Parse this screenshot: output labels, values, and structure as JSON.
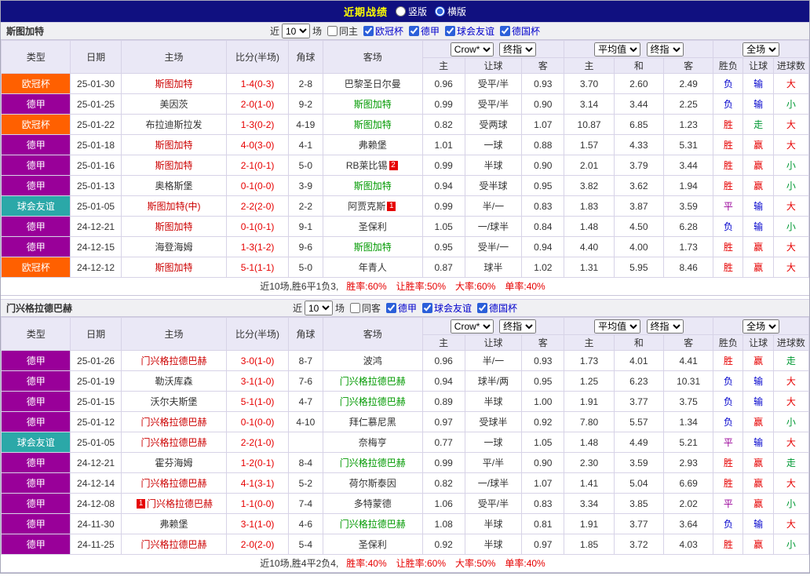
{
  "titlebar": {
    "title": "近期战绩",
    "vertical": "竖版",
    "horizontal": "横版"
  },
  "filter_labels": {
    "near": "近",
    "count": "10",
    "games": "场"
  },
  "table_header": {
    "type": "类型",
    "date": "日期",
    "home": "主场",
    "score": "比分(半场)",
    "corner": "角球",
    "away": "客场",
    "odds_company": "Crow*",
    "odds_kind": "终指",
    "avg_company": "平均值",
    "avg_kind": "终指",
    "full": "全场",
    "sub": [
      "主",
      "让球",
      "客",
      "主",
      "和",
      "客",
      "胜负",
      "让球",
      "进球数"
    ]
  },
  "league_colors": {
    "欧冠杯": "#ff6000",
    "德甲": "#990099",
    "球会友谊": "#2ba8a8"
  },
  "result_colors": {
    "胜": "#e60000",
    "平": "#990099",
    "负": "#0000cc",
    "赢": "#e60000",
    "输": "#0000cc",
    "走": "#009933",
    "大": "#e60000",
    "小": "#009933"
  },
  "team_colors": {
    "focal_home": "#cc0000",
    "focal_away": "#009900",
    "other": "#333333"
  },
  "sections": [
    {
      "team": "斯图加特",
      "filter_checkboxes": [
        {
          "label": "同主",
          "checked": false
        },
        {
          "label": "欧冠杯",
          "checked": true
        },
        {
          "label": "德甲",
          "checked": true
        },
        {
          "label": "球会友谊",
          "checked": true
        },
        {
          "label": "德国杯",
          "checked": true
        }
      ],
      "rows": [
        {
          "league": "欧冠杯",
          "date": "25-01-30",
          "home": "斯图加特",
          "home_focal": true,
          "home_badge": "",
          "score": "1-4(0-3)",
          "corner": "2-8",
          "away": "巴黎圣日尔曼",
          "away_focal": false,
          "away_badge": "",
          "odds_home": "0.96",
          "handicap": "受平/半",
          "odds_away": "0.93",
          "avg_home": "3.70",
          "avg_draw": "2.60",
          "avg_away": "2.49",
          "result": "负",
          "handicap_result": "输",
          "goals_result": "大"
        },
        {
          "league": "德甲",
          "date": "25-01-25",
          "home": "美因茨",
          "home_focal": false,
          "home_badge": "",
          "score": "2-0(1-0)",
          "corner": "9-2",
          "away": "斯图加特",
          "away_focal": true,
          "away_badge": "",
          "odds_home": "0.99",
          "handicap": "受平/半",
          "odds_away": "0.90",
          "avg_home": "3.14",
          "avg_draw": "3.44",
          "avg_away": "2.25",
          "result": "负",
          "handicap_result": "输",
          "goals_result": "小"
        },
        {
          "league": "欧冠杯",
          "date": "25-01-22",
          "home": "布拉迪斯拉发",
          "home_focal": false,
          "home_badge": "",
          "score": "1-3(0-2)",
          "corner": "4-19",
          "away": "斯图加特",
          "away_focal": true,
          "away_badge": "",
          "odds_home": "0.82",
          "handicap": "受两球",
          "odds_away": "1.07",
          "avg_home": "10.87",
          "avg_draw": "6.85",
          "avg_away": "1.23",
          "result": "胜",
          "handicap_result": "走",
          "goals_result": "大"
        },
        {
          "league": "德甲",
          "date": "25-01-18",
          "home": "斯图加特",
          "home_focal": true,
          "home_badge": "",
          "score": "4-0(3-0)",
          "corner": "4-1",
          "away": "弗赖堡",
          "away_focal": false,
          "away_badge": "",
          "odds_home": "1.01",
          "handicap": "一球",
          "odds_away": "0.88",
          "avg_home": "1.57",
          "avg_draw": "4.33",
          "avg_away": "5.31",
          "result": "胜",
          "handicap_result": "赢",
          "goals_result": "大"
        },
        {
          "league": "德甲",
          "date": "25-01-16",
          "home": "斯图加特",
          "home_focal": true,
          "home_badge": "",
          "score": "2-1(0-1)",
          "corner": "5-0",
          "away": "RB莱比锡",
          "away_focal": false,
          "away_badge": "2",
          "odds_home": "0.99",
          "handicap": "半球",
          "odds_away": "0.90",
          "avg_home": "2.01",
          "avg_draw": "3.79",
          "avg_away": "3.44",
          "result": "胜",
          "handicap_result": "赢",
          "goals_result": "小"
        },
        {
          "league": "德甲",
          "date": "25-01-13",
          "home": "奥格斯堡",
          "home_focal": false,
          "home_badge": "",
          "score": "0-1(0-0)",
          "corner": "3-9",
          "away": "斯图加特",
          "away_focal": true,
          "away_badge": "",
          "odds_home": "0.94",
          "handicap": "受半球",
          "odds_away": "0.95",
          "avg_home": "3.82",
          "avg_draw": "3.62",
          "avg_away": "1.94",
          "result": "胜",
          "handicap_result": "赢",
          "goals_result": "小"
        },
        {
          "league": "球会友谊",
          "date": "25-01-05",
          "home": "斯图加特(中)",
          "home_focal": true,
          "home_badge": "",
          "score": "2-2(2-0)",
          "corner": "2-2",
          "away": "阿贾克斯",
          "away_focal": false,
          "away_badge": "1",
          "odds_home": "0.99",
          "handicap": "半/一",
          "odds_away": "0.83",
          "avg_home": "1.83",
          "avg_draw": "3.87",
          "avg_away": "3.59",
          "result": "平",
          "handicap_result": "输",
          "goals_result": "大"
        },
        {
          "league": "德甲",
          "date": "24-12-21",
          "home": "斯图加特",
          "home_focal": true,
          "home_badge": "",
          "score": "0-1(0-1)",
          "corner": "9-1",
          "away": "圣保利",
          "away_focal": false,
          "away_badge": "",
          "odds_home": "1.05",
          "handicap": "一/球半",
          "odds_away": "0.84",
          "avg_home": "1.48",
          "avg_draw": "4.50",
          "avg_away": "6.28",
          "result": "负",
          "handicap_result": "输",
          "goals_result": "小"
        },
        {
          "league": "德甲",
          "date": "24-12-15",
          "home": "海登海姆",
          "home_focal": false,
          "home_badge": "",
          "score": "1-3(1-2)",
          "corner": "9-6",
          "away": "斯图加特",
          "away_focal": true,
          "away_badge": "",
          "odds_home": "0.95",
          "handicap": "受半/一",
          "odds_away": "0.94",
          "avg_home": "4.40",
          "avg_draw": "4.00",
          "avg_away": "1.73",
          "result": "胜",
          "handicap_result": "赢",
          "goals_result": "大"
        },
        {
          "league": "欧冠杯",
          "date": "24-12-12",
          "home": "斯图加特",
          "home_focal": true,
          "home_badge": "",
          "score": "5-1(1-1)",
          "corner": "5-0",
          "away": "年青人",
          "away_focal": false,
          "away_badge": "",
          "odds_home": "0.87",
          "handicap": "球半",
          "odds_away": "1.02",
          "avg_home": "1.31",
          "avg_draw": "5.95",
          "avg_away": "8.46",
          "result": "胜",
          "handicap_result": "赢",
          "goals_result": "大"
        }
      ],
      "summary_intro": "近10场,胜6平1负3,",
      "summary_stats": [
        "胜率:60%",
        "让胜率:50%",
        "大率:60%",
        "单率:40%"
      ]
    },
    {
      "team": "门兴格拉德巴赫",
      "filter_checkboxes": [
        {
          "label": "同客",
          "checked": false
        },
        {
          "label": "德甲",
          "checked": true
        },
        {
          "label": "球会友谊",
          "checked": true
        },
        {
          "label": "德国杯",
          "checked": true
        }
      ],
      "rows": [
        {
          "league": "德甲",
          "date": "25-01-26",
          "home": "门兴格拉德巴赫",
          "home_focal": true,
          "home_badge": "",
          "score": "3-0(1-0)",
          "corner": "8-7",
          "away": "波鸿",
          "away_focal": false,
          "away_badge": "",
          "odds_home": "0.96",
          "handicap": "半/一",
          "odds_away": "0.93",
          "avg_home": "1.73",
          "avg_draw": "4.01",
          "avg_away": "4.41",
          "result": "胜",
          "handicap_result": "赢",
          "goals_result": "走"
        },
        {
          "league": "德甲",
          "date": "25-01-19",
          "home": "勒沃库森",
          "home_focal": false,
          "home_badge": "",
          "score": "3-1(1-0)",
          "corner": "7-6",
          "away": "门兴格拉德巴赫",
          "away_focal": true,
          "away_badge": "",
          "odds_home": "0.94",
          "handicap": "球半/两",
          "odds_away": "0.95",
          "avg_home": "1.25",
          "avg_draw": "6.23",
          "avg_away": "10.31",
          "result": "负",
          "handicap_result": "输",
          "goals_result": "大"
        },
        {
          "league": "德甲",
          "date": "25-01-15",
          "home": "沃尔夫斯堡",
          "home_focal": false,
          "home_badge": "",
          "score": "5-1(1-0)",
          "corner": "4-7",
          "away": "门兴格拉德巴赫",
          "away_focal": true,
          "away_badge": "",
          "odds_home": "0.89",
          "handicap": "半球",
          "odds_away": "1.00",
          "avg_home": "1.91",
          "avg_draw": "3.77",
          "avg_away": "3.75",
          "result": "负",
          "handicap_result": "输",
          "goals_result": "大"
        },
        {
          "league": "德甲",
          "date": "25-01-12",
          "home": "门兴格拉德巴赫",
          "home_focal": true,
          "home_badge": "",
          "score": "0-1(0-0)",
          "corner": "4-10",
          "away": "拜仁慕尼黑",
          "away_focal": false,
          "away_badge": "",
          "odds_home": "0.97",
          "handicap": "受球半",
          "odds_away": "0.92",
          "avg_home": "7.80",
          "avg_draw": "5.57",
          "avg_away": "1.34",
          "result": "负",
          "handicap_result": "赢",
          "goals_result": "小"
        },
        {
          "league": "球会友谊",
          "date": "25-01-05",
          "home": "门兴格拉德巴赫",
          "home_focal": true,
          "home_badge": "",
          "score": "2-2(1-0)",
          "corner": "",
          "away": "奈梅亨",
          "away_focal": false,
          "away_badge": "",
          "odds_home": "0.77",
          "handicap": "一球",
          "odds_away": "1.05",
          "avg_home": "1.48",
          "avg_draw": "4.49",
          "avg_away": "5.21",
          "result": "平",
          "handicap_result": "输",
          "goals_result": "大"
        },
        {
          "league": "德甲",
          "date": "24-12-21",
          "home": "霍芬海姆",
          "home_focal": false,
          "home_badge": "",
          "score": "1-2(0-1)",
          "corner": "8-4",
          "away": "门兴格拉德巴赫",
          "away_focal": true,
          "away_badge": "",
          "odds_home": "0.99",
          "handicap": "平/半",
          "odds_away": "0.90",
          "avg_home": "2.30",
          "avg_draw": "3.59",
          "avg_away": "2.93",
          "result": "胜",
          "handicap_result": "赢",
          "goals_result": "走"
        },
        {
          "league": "德甲",
          "date": "24-12-14",
          "home": "门兴格拉德巴赫",
          "home_focal": true,
          "home_badge": "",
          "score": "4-1(3-1)",
          "corner": "5-2",
          "away": "荷尔斯泰因",
          "away_focal": false,
          "away_badge": "",
          "odds_home": "0.82",
          "handicap": "一/球半",
          "odds_away": "1.07",
          "avg_home": "1.41",
          "avg_draw": "5.04",
          "avg_away": "6.69",
          "result": "胜",
          "handicap_result": "赢",
          "goals_result": "大"
        },
        {
          "league": "德甲",
          "date": "24-12-08",
          "home": "门兴格拉德巴赫",
          "home_focal": true,
          "home_badge": "1",
          "score": "1-1(0-0)",
          "corner": "7-4",
          "away": "多特蒙德",
          "away_focal": false,
          "away_badge": "",
          "odds_home": "1.06",
          "handicap": "受平/半",
          "odds_away": "0.83",
          "avg_home": "3.34",
          "avg_draw": "3.85",
          "avg_away": "2.02",
          "result": "平",
          "handicap_result": "赢",
          "goals_result": "小"
        },
        {
          "league": "德甲",
          "date": "24-11-30",
          "home": "弗赖堡",
          "home_focal": false,
          "home_badge": "",
          "score": "3-1(1-0)",
          "corner": "4-6",
          "away": "门兴格拉德巴赫",
          "away_focal": true,
          "away_badge": "",
          "odds_home": "1.08",
          "handicap": "半球",
          "odds_away": "0.81",
          "avg_home": "1.91",
          "avg_draw": "3.77",
          "avg_away": "3.64",
          "result": "负",
          "handicap_result": "输",
          "goals_result": "大"
        },
        {
          "league": "德甲",
          "date": "24-11-25",
          "home": "门兴格拉德巴赫",
          "home_focal": true,
          "home_badge": "",
          "score": "2-0(2-0)",
          "corner": "5-4",
          "away": "圣保利",
          "away_focal": false,
          "away_badge": "",
          "odds_home": "0.92",
          "handicap": "半球",
          "odds_away": "0.97",
          "avg_home": "1.85",
          "avg_draw": "3.72",
          "avg_away": "4.03",
          "result": "胜",
          "handicap_result": "赢",
          "goals_result": "小"
        }
      ],
      "summary_intro": "近10场,胜4平2负4,",
      "summary_stats": [
        "胜率:40%",
        "让胜率:60%",
        "大率:50%",
        "单率:40%"
      ]
    }
  ]
}
